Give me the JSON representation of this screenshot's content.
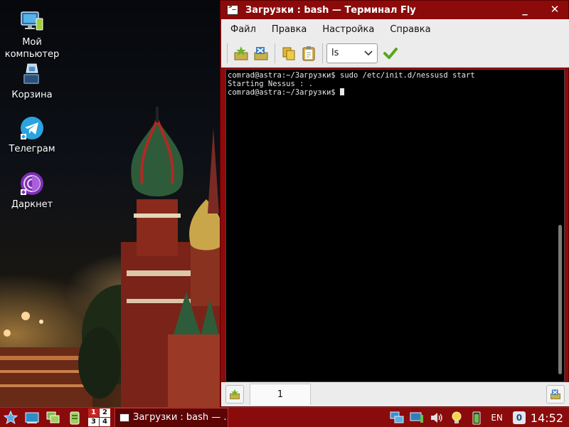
{
  "desktop": {
    "icons": [
      {
        "label_line1": "Мой",
        "label_line2": "компьютер"
      },
      {
        "label_line1": "Корзина"
      },
      {
        "label_line1": "Телеграм"
      },
      {
        "label_line1": "Даркнет"
      }
    ]
  },
  "window": {
    "title": "Загрузки : bash — Терминал Fly",
    "menu": [
      "Файл",
      "Правка",
      "Настройка",
      "Справка"
    ],
    "toolbar": {
      "command_value": "ls"
    },
    "terminal": {
      "lines": [
        "comrad@astra:~/Загрузки$ sudo /etc/init.d/nessusd start",
        "Starting Nessus : .",
        "comrad@astra:~/Загрузки$ "
      ]
    },
    "tab_label": "1"
  },
  "taskbar": {
    "pager": [
      "1",
      "2",
      "3",
      "4"
    ],
    "active_task": "Загрузки : bash — ...",
    "language": "EN",
    "notifications": "0",
    "clock": "14:52"
  },
  "colors": {
    "window_frame": "#8c0a0a",
    "taskbar": "#8a0b0b",
    "terminal_bg": "#000000"
  }
}
